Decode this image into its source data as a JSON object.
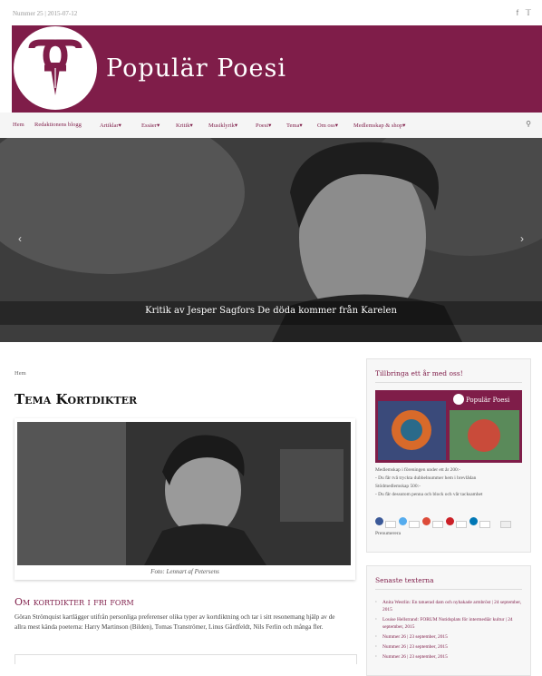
{
  "topbar": {
    "issue": "Nummer 25 | 2015-07-12",
    "social": [
      "facebook-icon",
      "twitter-icon"
    ]
  },
  "header": {
    "title": "Populär Poesi"
  },
  "nav": {
    "items": [
      "Hem",
      "Redaktionens blogg",
      "Artiklar",
      "Essäer",
      "Kritik",
      "Musiklyrik",
      "Poesi",
      "Tema",
      "Om oss",
      "Medlemskap & shop"
    ],
    "dropdown": [
      false,
      false,
      true,
      true,
      true,
      true,
      true,
      true,
      true,
      true
    ],
    "search_icon": "search-icon"
  },
  "slider": {
    "caption": "Kritik av Jesper Sagfors De döda kommer från Karelen",
    "prev_icon": "chevron-left-icon",
    "next_icon": "chevron-right-icon"
  },
  "main": {
    "breadcrumb": "Hem",
    "title": "Tema Kortdikter",
    "photo_caption": "Foto: Lennart af Petersens",
    "section_heading": "Om kortdikter i fri form",
    "intro": "Göran Strömquist kartlägger utifrån personliga preferenser olika typer av kortdiktning och tar i sitt resonemang hjälp av de allra mest kända poeterna: Harry Martinson (Bilden), Tomas Tranströmer, Linus Gårdfeldt, Nils Ferlin och många fler."
  },
  "sidebar": {
    "membership": {
      "title": "Tillbringa ett år med oss!",
      "cover_title": "Populär Poesi",
      "lines": [
        "Medlemskap i föreningen under ett år 200:-",
        "- Du får två tryckta dubbelnummer hem i brevlådan",
        "Stödmedlemskap 500:-",
        "- Du får dessutom penna och block och vår tacksamhet"
      ],
      "share_label": "Prenumerera"
    },
    "latest": {
      "title": "Senaste texterna",
      "items": [
        "Anita Westlin: En tatuerad dam och nyhakade armbröst | 24 september, 2015",
        "Louise Hellstrand: FORUM Nutidsplats för intermediär kultur | 24 september, 2015",
        "Nummer 26 | 23 september, 2015",
        "Nummer 26 | 23 september, 2015",
        "Nummer 26 | 23 september, 2015"
      ]
    }
  },
  "colors": {
    "brand": "#7f1d49",
    "nav_bg": "#f5f5f5",
    "sidebar_bg": "#f7f7f7"
  }
}
